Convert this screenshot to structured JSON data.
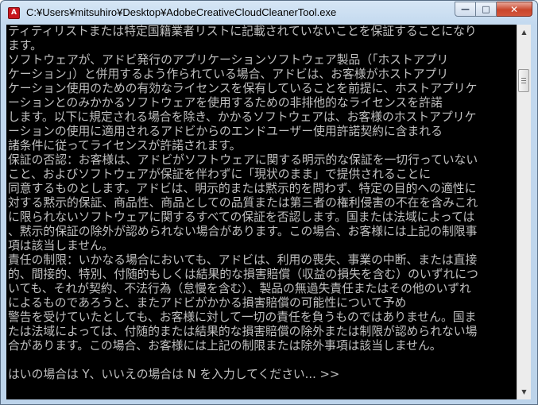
{
  "window": {
    "title": "C:¥Users¥mitsuhiro¥Desktop¥AdobeCreativeCloudCleanerTool.exe",
    "icon": "adobe-app-icon",
    "controls": {
      "minimize": "—",
      "maximize": "□",
      "close": "✕"
    }
  },
  "console": {
    "lines": [
      "ティティリストまたは特定国籍業者リストに記載されていないことを保証することになり",
      "ます。",
      "ソフトウェアが、アドビ発行のアプリケーションソフトウェア製品（「ホストアプリ",
      "ケーション」）と併用するよう作られている場合、アドビは、お客様がホストアプリ",
      "ケーション使用のための有効なライセンスを保有していることを前提に、ホストアプリケ",
      "ーションとのみかかるソフトウェアを使用するための非排他的なライセンスを許諾",
      "します。以下に規定される場合を除き、かかるソフトウェアは、お客様のホストアプリケ",
      "ーションの使用に適用されるアドビからのエンドユーザー使用許諾契約に含まれる",
      "諸条件に従ってライセンスが許諾されます。",
      "保証の否認：お客様は、アドビがソフトウェアに関する明示的な保証を一切行っていない",
      "こと、およびソフトウェアが保証を伴わずに「現状のまま」で提供されることに",
      "同意するものとします。アドビは、明示的または黙示的を問わず、特定の目的への適性に",
      "対する黙示的保証、商品性、商品としての品質または第三者の権利侵害の不在を含みこれ",
      "に限られないソフトウェアに関するすべての保証を否認します。国または法域によっては",
      "、黙示的保証の除外が認められない場合があります。この場合、お客様には上記の制限事",
      "項は該当しません。",
      "責任の制限：いかなる場合においても、アドビは、利用の喪失、事業の中断、または直接",
      "的、間接的、特別、付随的もしくは結果的な損害賠償（収益の損失を含む）のいずれにつ",
      "いても、それが契約、不法行為（怠慢を含む）、製品の無過失責任またはその他のいずれ",
      "によるものであろうと、またアドビがかかる損害賠償の可能性について予め",
      "警告を受けていたとしても、お客様に対して一切の責任を負うものではありません。国ま",
      "たは法域によっては、付随的または結果的な損害賠償の除外または制限が認められない場",
      "合があります。この場合、お客様には上記の制限または除外事項は該当しません。",
      "",
      "はいの場合は Y、いいえの場合は N を入力してください... >>"
    ]
  },
  "scrollbar": {
    "up": "▲",
    "down": "▼"
  }
}
